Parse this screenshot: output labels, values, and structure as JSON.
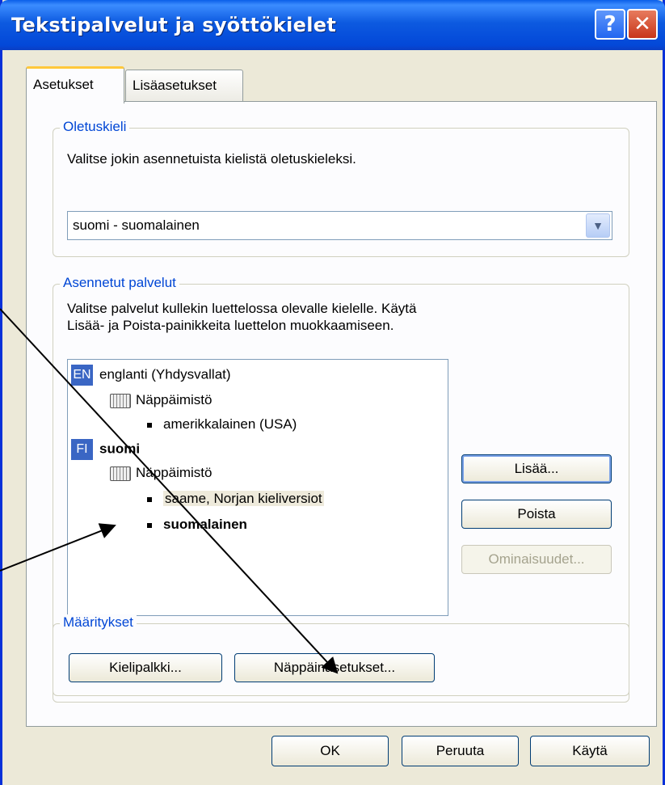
{
  "window": {
    "title": "Tekstipalvelut ja syöttökielet",
    "help_glyph": "?",
    "close_glyph": "✕"
  },
  "tabs": [
    {
      "label": "Asetukset",
      "active": true
    },
    {
      "label": "Lisäasetukset",
      "active": false
    }
  ],
  "default_language": {
    "legend": "Oletuskieli",
    "description": "Valitse jokin asennetuista kielistä oletuskieleksi.",
    "selected": "suomi - suomalainen"
  },
  "installed_services": {
    "legend": "Asennetut palvelut",
    "description_line1": "Valitse palvelut kullekin luettelossa olevalle kielelle. Käytä",
    "description_line2": "Lisää- ja Poista-painikkeita luettelon muokkaamiseen.",
    "tree": {
      "en_badge": "EN",
      "en_label": "englanti (Yhdysvallat)",
      "en_keyboard": "Näppäimistö",
      "en_layout": "amerikkalainen (USA)",
      "fi_badge": "FI",
      "fi_label": "suomi",
      "fi_keyboard": "Näppäimistö",
      "fi_layout1": "saame, Norjan kieliversiot",
      "fi_layout2": "suomalainen"
    },
    "buttons": {
      "add": "Lisää...",
      "remove": "Poista",
      "properties": "Ominaisuudet..."
    }
  },
  "settings": {
    "legend": "Määritykset",
    "language_bar": "Kielipalkki...",
    "key_settings": "Näppäinasetukset..."
  },
  "footer": {
    "ok": "OK",
    "cancel": "Peruuta",
    "apply": "Käytä"
  },
  "colors": {
    "titlebar": "#0a5fe8",
    "legend": "#0046d5",
    "badge": "#3a66c4",
    "active_tab_accent": "#ffc83c"
  }
}
